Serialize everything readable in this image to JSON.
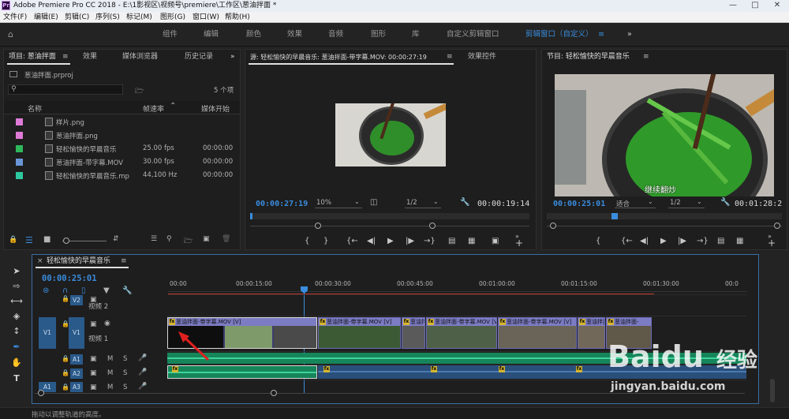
{
  "window": {
    "title": "Adobe Premiere Pro CC 2018 - E:\\1影视区\\视频号\\premiere\\工作区\\葱油拌面 *",
    "app_abbr": "Pr"
  },
  "menu": [
    "文件(F)",
    "编辑(E)",
    "剪辑(C)",
    "序列(S)",
    "标记(M)",
    "图形(G)",
    "窗口(W)",
    "帮助(H)"
  ],
  "workspaces": [
    "组件",
    "编辑",
    "颜色",
    "效果",
    "音频",
    "图形",
    "库",
    "自定义剪辑窗口",
    "剪辑窗口（自定义）"
  ],
  "project_panel": {
    "tabs": [
      "项目: 葱油拌面",
      "效果",
      "媒体浏览器",
      "历史记录"
    ],
    "file": "葱油拌面.prproj",
    "item_count": "5 个项",
    "columns": [
      "名称",
      "帧速率",
      "媒体开始"
    ],
    "items": [
      {
        "name": "样片.png",
        "fps": "",
        "start": "",
        "color": "#e07ad8"
      },
      {
        "name": "葱油拌面.png",
        "fps": "",
        "start": "",
        "color": "#e07ad8"
      },
      {
        "name": "轻松愉快的早晨音乐",
        "fps": "25.00 fps",
        "start": "00:00:00",
        "color": "#2eb85c"
      },
      {
        "name": "葱油拌面-带字幕.MOV",
        "fps": "30.00 fps",
        "start": "00:00:00",
        "color": "#6a96d8"
      },
      {
        "name": "轻松愉快的早晨音乐.mp",
        "fps": "44,100 Hz",
        "start": "00:00:00",
        "color": "#2ec8a0"
      }
    ]
  },
  "source_monitor": {
    "tabs": [
      "源: 轻松愉快的早晨音乐: 葱油拌面-带字幕.MOV: 00:00:27:19",
      "效果控件"
    ],
    "timecode": "00:00:27:19",
    "zoom": "10%",
    "resolution": "1/2",
    "duration": "00:00:19:14"
  },
  "program_monitor": {
    "tab": "节目: 轻松愉快的早晨音乐",
    "timecode": "00:00:25:01",
    "zoom": "适合",
    "resolution": "1/2",
    "duration": "00:01:28:2",
    "subtitle": "继续翻炒"
  },
  "timeline": {
    "tab": "轻松愉快的早晨音乐",
    "timecode": "00:00:25:01",
    "ruler": [
      "00:00",
      "00:00:15:00",
      "00:00:30:00",
      "00:00:45:00",
      "00:01:00:00",
      "00:01:15:00",
      "00:01:30:00",
      "00:0"
    ],
    "tracks": [
      {
        "id": "V2",
        "name": "视频 2"
      },
      {
        "id": "V1",
        "src": "V1",
        "name": "视频 1"
      },
      {
        "id": "A1",
        "m": "M",
        "s": "S"
      },
      {
        "id": "A2",
        "m": "M",
        "s": "S"
      },
      {
        "id": "A3",
        "src": "A1",
        "m": "M",
        "s": "S"
      }
    ],
    "clip_label": "葱油拌面-带字幕.MOV [V]",
    "clip_label_short": "葱油拌面-",
    "clip_label_fx": "fx"
  },
  "status_bar": "拖动以调整轨道的高度。",
  "watermark": {
    "brand": "Baidu",
    "brand_cn": "经验",
    "url": "jingyan.baidu.com"
  },
  "colors": {
    "accent": "#3a8dde",
    "playhead": "#3a8dde",
    "audio": "#1aa46e",
    "video_clip": "#7c7cc4",
    "annotation_arrow": "#e02020"
  }
}
